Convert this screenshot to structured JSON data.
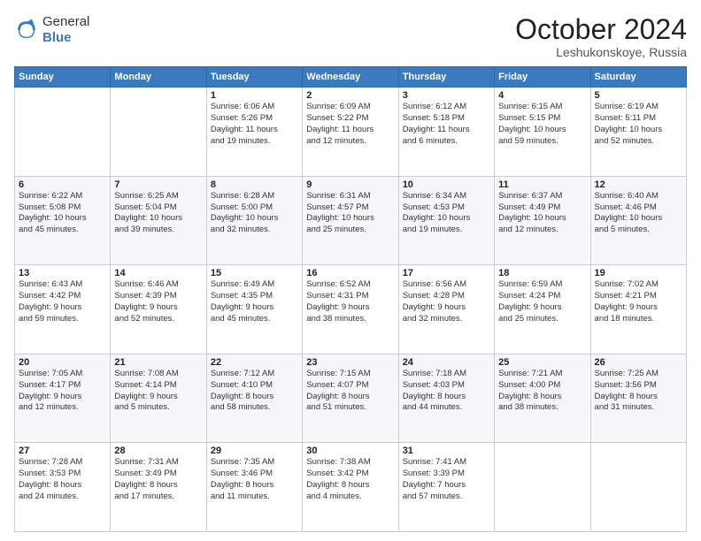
{
  "logo": {
    "general": "General",
    "blue": "Blue"
  },
  "header": {
    "month": "October 2024",
    "location": "Leshukonskoye, Russia"
  },
  "weekdays": [
    "Sunday",
    "Monday",
    "Tuesday",
    "Wednesday",
    "Thursday",
    "Friday",
    "Saturday"
  ],
  "weeks": [
    [
      {
        "day": "",
        "info": ""
      },
      {
        "day": "",
        "info": ""
      },
      {
        "day": "1",
        "info": "Sunrise: 6:06 AM\nSunset: 5:26 PM\nDaylight: 11 hours\nand 19 minutes."
      },
      {
        "day": "2",
        "info": "Sunrise: 6:09 AM\nSunset: 5:22 PM\nDaylight: 11 hours\nand 12 minutes."
      },
      {
        "day": "3",
        "info": "Sunrise: 6:12 AM\nSunset: 5:18 PM\nDaylight: 11 hours\nand 6 minutes."
      },
      {
        "day": "4",
        "info": "Sunrise: 6:15 AM\nSunset: 5:15 PM\nDaylight: 10 hours\nand 59 minutes."
      },
      {
        "day": "5",
        "info": "Sunrise: 6:19 AM\nSunset: 5:11 PM\nDaylight: 10 hours\nand 52 minutes."
      }
    ],
    [
      {
        "day": "6",
        "info": "Sunrise: 6:22 AM\nSunset: 5:08 PM\nDaylight: 10 hours\nand 45 minutes."
      },
      {
        "day": "7",
        "info": "Sunrise: 6:25 AM\nSunset: 5:04 PM\nDaylight: 10 hours\nand 39 minutes."
      },
      {
        "day": "8",
        "info": "Sunrise: 6:28 AM\nSunset: 5:00 PM\nDaylight: 10 hours\nand 32 minutes."
      },
      {
        "day": "9",
        "info": "Sunrise: 6:31 AM\nSunset: 4:57 PM\nDaylight: 10 hours\nand 25 minutes."
      },
      {
        "day": "10",
        "info": "Sunrise: 6:34 AM\nSunset: 4:53 PM\nDaylight: 10 hours\nand 19 minutes."
      },
      {
        "day": "11",
        "info": "Sunrise: 6:37 AM\nSunset: 4:49 PM\nDaylight: 10 hours\nand 12 minutes."
      },
      {
        "day": "12",
        "info": "Sunrise: 6:40 AM\nSunset: 4:46 PM\nDaylight: 10 hours\nand 5 minutes."
      }
    ],
    [
      {
        "day": "13",
        "info": "Sunrise: 6:43 AM\nSunset: 4:42 PM\nDaylight: 9 hours\nand 59 minutes."
      },
      {
        "day": "14",
        "info": "Sunrise: 6:46 AM\nSunset: 4:39 PM\nDaylight: 9 hours\nand 52 minutes."
      },
      {
        "day": "15",
        "info": "Sunrise: 6:49 AM\nSunset: 4:35 PM\nDaylight: 9 hours\nand 45 minutes."
      },
      {
        "day": "16",
        "info": "Sunrise: 6:52 AM\nSunset: 4:31 PM\nDaylight: 9 hours\nand 38 minutes."
      },
      {
        "day": "17",
        "info": "Sunrise: 6:56 AM\nSunset: 4:28 PM\nDaylight: 9 hours\nand 32 minutes."
      },
      {
        "day": "18",
        "info": "Sunrise: 6:59 AM\nSunset: 4:24 PM\nDaylight: 9 hours\nand 25 minutes."
      },
      {
        "day": "19",
        "info": "Sunrise: 7:02 AM\nSunset: 4:21 PM\nDaylight: 9 hours\nand 18 minutes."
      }
    ],
    [
      {
        "day": "20",
        "info": "Sunrise: 7:05 AM\nSunset: 4:17 PM\nDaylight: 9 hours\nand 12 minutes."
      },
      {
        "day": "21",
        "info": "Sunrise: 7:08 AM\nSunset: 4:14 PM\nDaylight: 9 hours\nand 5 minutes."
      },
      {
        "day": "22",
        "info": "Sunrise: 7:12 AM\nSunset: 4:10 PM\nDaylight: 8 hours\nand 58 minutes."
      },
      {
        "day": "23",
        "info": "Sunrise: 7:15 AM\nSunset: 4:07 PM\nDaylight: 8 hours\nand 51 minutes."
      },
      {
        "day": "24",
        "info": "Sunrise: 7:18 AM\nSunset: 4:03 PM\nDaylight: 8 hours\nand 44 minutes."
      },
      {
        "day": "25",
        "info": "Sunrise: 7:21 AM\nSunset: 4:00 PM\nDaylight: 8 hours\nand 38 minutes."
      },
      {
        "day": "26",
        "info": "Sunrise: 7:25 AM\nSunset: 3:56 PM\nDaylight: 8 hours\nand 31 minutes."
      }
    ],
    [
      {
        "day": "27",
        "info": "Sunrise: 7:28 AM\nSunset: 3:53 PM\nDaylight: 8 hours\nand 24 minutes."
      },
      {
        "day": "28",
        "info": "Sunrise: 7:31 AM\nSunset: 3:49 PM\nDaylight: 8 hours\nand 17 minutes."
      },
      {
        "day": "29",
        "info": "Sunrise: 7:35 AM\nSunset: 3:46 PM\nDaylight: 8 hours\nand 11 minutes."
      },
      {
        "day": "30",
        "info": "Sunrise: 7:38 AM\nSunset: 3:42 PM\nDaylight: 8 hours\nand 4 minutes."
      },
      {
        "day": "31",
        "info": "Sunrise: 7:41 AM\nSunset: 3:39 PM\nDaylight: 7 hours\nand 57 minutes."
      },
      {
        "day": "",
        "info": ""
      },
      {
        "day": "",
        "info": ""
      }
    ]
  ]
}
